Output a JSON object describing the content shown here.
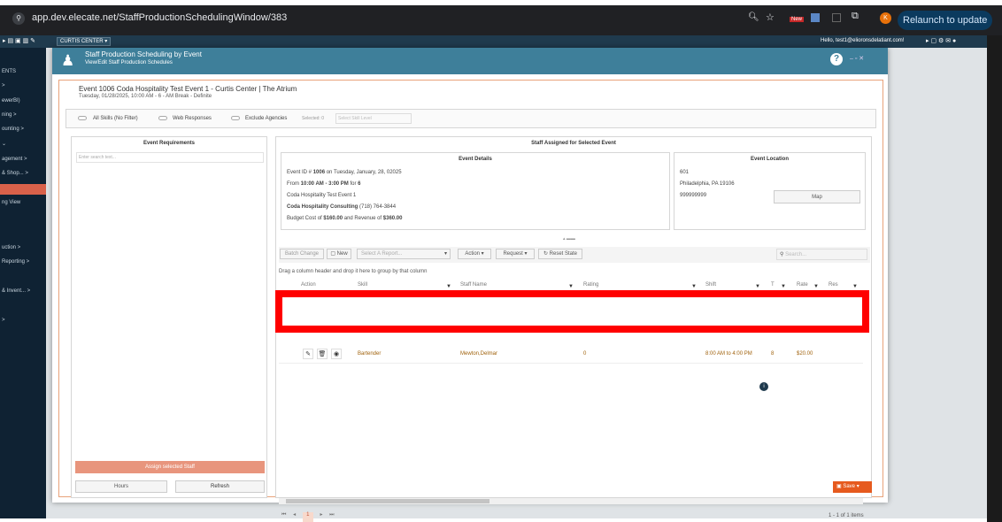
{
  "browser": {
    "url": "app.dev.elecate.net/StaffProductionSchedulingWindow/383",
    "new_badge": "New",
    "relaunch": "Relaunch to update"
  },
  "appbar": {
    "location": "CURTIS CENTER",
    "user_text": "Hello, test1@elioronsdelatiant.com!"
  },
  "sidebar": {
    "items": [
      "ENTS",
      "ewerBI)",
      "ning >",
      "ounting >",
      "agement >",
      "& Shop... >",
      "ng View",
      "uction >",
      "Reporting >",
      "& Invent... >"
    ]
  },
  "modal": {
    "title": "Staff Production Scheduling by Event",
    "subtitle": "View/Edit Staff Production Schedules",
    "help": "?",
    "event_title": "Event 1006 Coda Hospitality Test Event 1 - Curtis Center | The Atrium",
    "event_sub": "Tuesday, 01/28/2025, 10:00 AM - 6 - AM Break - Definite",
    "filters": {
      "all_skills": "All Skills (No Filter)",
      "web_responses": "Web Responses",
      "exclude_agencies": "Exclude Agencies",
      "selected": "Selected: 0",
      "skill_level_placeholder": "Select Skill Level"
    },
    "requirements": {
      "title": "Event Requirements",
      "search_placeholder": "Enter search text...",
      "assign": "Assign selected Staff",
      "hours": "Hours",
      "refresh": "Refresh"
    },
    "assigned": {
      "title": "Staff Assigned for Selected Event"
    },
    "details": {
      "title": "Event Details",
      "id_pre": "Event ID # ",
      "id": "1006",
      "id_post": " on Tuesday, January, 28, 02025",
      "from_pre": "From ",
      "time": "10:00 AM - 3:00 PM",
      "for": " for ",
      "count": "6",
      "event_name": "Coda Hospitality Test Event 1",
      "company": "Coda Hospitality Consulting",
      "phone": " (718) 764-3844",
      "budget_pre": "Budget Cost of ",
      "budget": "$160.00",
      "rev_pre": " and Revenue of ",
      "revenue": "$360.00"
    },
    "location": {
      "title": "Event Location",
      "line1": "601",
      "line2": "Philadelphia, PA 19106",
      "line3": "999999999",
      "map": "Map"
    },
    "toolbar": {
      "batch": "Batch Change",
      "new": "New",
      "report_placeholder": "Select A Report...",
      "action": "Action",
      "request": "Request",
      "reset": "Reset State",
      "search_placeholder": "Search..."
    },
    "group_hint": "Drag a column header and drop it here to group by that column",
    "columns": [
      "Action",
      "Skill",
      "Staff Name",
      "Rating",
      "Shift",
      "T",
      "Rate",
      "Res"
    ],
    "row": {
      "skill": "Bartender",
      "staff": "Mewton,Delmar",
      "rating": "0",
      "shift": "8:00 AM to 4:00 PM",
      "t": "8",
      "rate": "$20.00"
    },
    "pager": {
      "page": "1",
      "count": "1 - 1 of 1 items"
    },
    "save": "Save"
  }
}
